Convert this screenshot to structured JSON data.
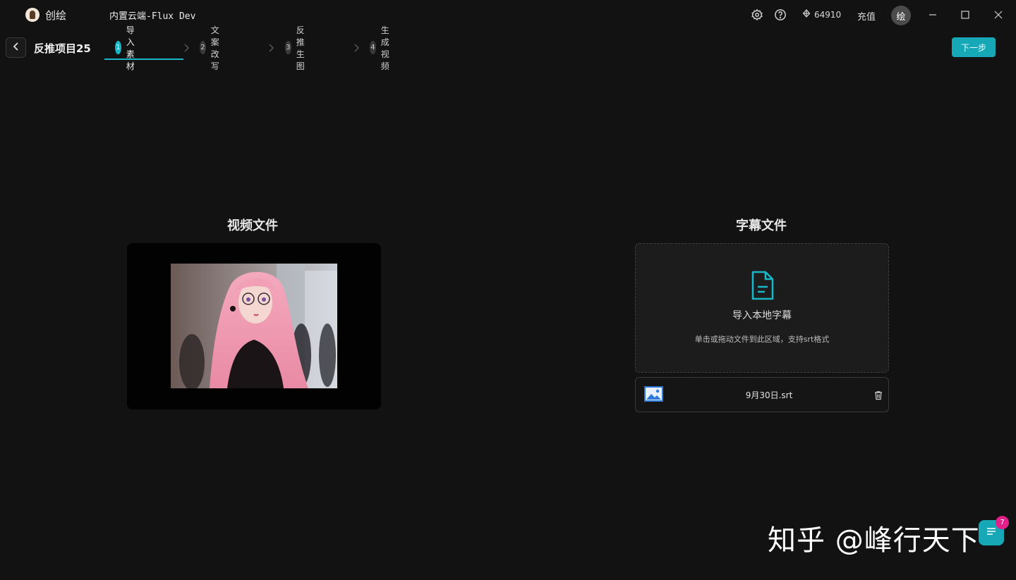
{
  "app": {
    "name": "创绘",
    "model": "内置云端-Flux Dev",
    "credits": "64910",
    "recharge_label": "充值",
    "avatar_text": "绘"
  },
  "header": {
    "project_title": "反推项目25",
    "next_label": "下一步",
    "steps": [
      {
        "num": "1",
        "label": "导入素材",
        "active": true
      },
      {
        "num": "2",
        "label": "文案改写",
        "active": false
      },
      {
        "num": "3",
        "label": "反推生图",
        "active": false
      },
      {
        "num": "4",
        "label": "生成视频",
        "active": false
      }
    ]
  },
  "video": {
    "title": "视频文件"
  },
  "subtitle": {
    "title": "字幕文件",
    "import_label": "导入本地字幕",
    "hint": "单击或拖动文件到此区域，支持srt格式",
    "file_name": "9月30日.srt"
  },
  "watermark": "知乎 @峰行天下",
  "fab": {
    "badge_count": "7"
  },
  "icons": {
    "settings": "gear-icon",
    "help": "help-circle-icon",
    "credits": "gem-icon",
    "back": "chevron-left-icon",
    "document": "document-icon",
    "image": "image-icon",
    "delete": "trash-icon",
    "chat": "chat-icon"
  },
  "colors": {
    "accent": "#18b6c6",
    "background": "#121212",
    "badge": "#e0218a"
  }
}
